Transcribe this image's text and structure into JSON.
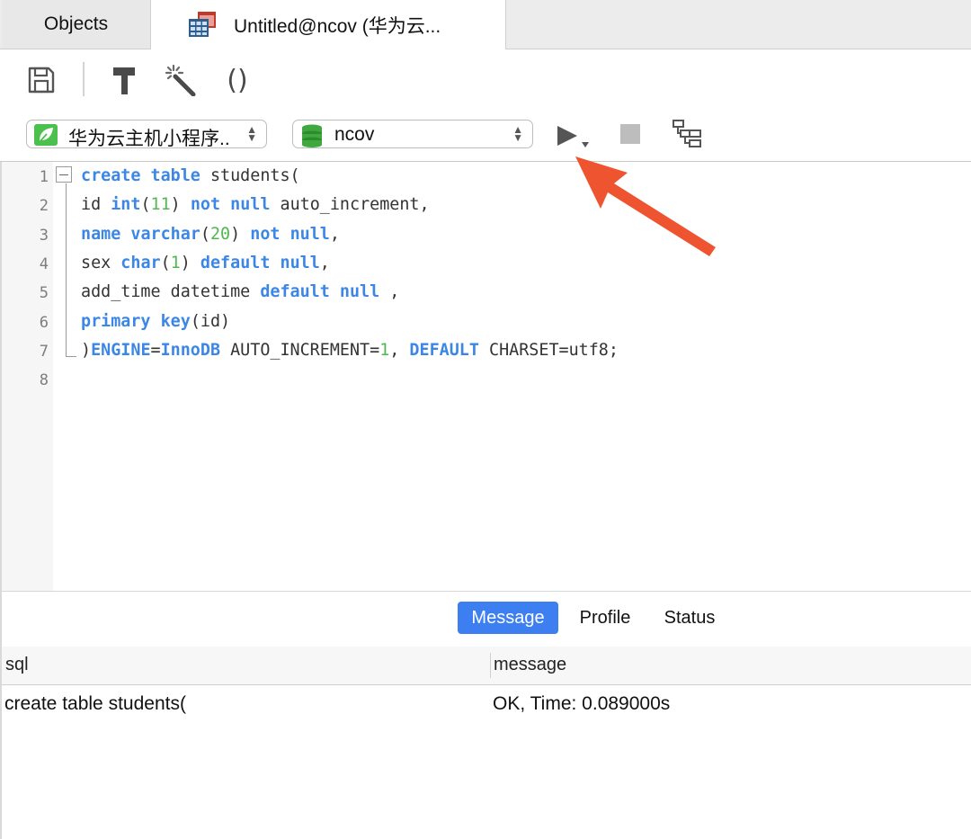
{
  "tabs": {
    "objects": "Objects",
    "query": "Untitled@ncov (华为云..."
  },
  "toolbar": {
    "save_icon": "save-icon",
    "build_icon": "hammer-icon",
    "beautify_icon": "magic-wand-icon",
    "parens_label": "()"
  },
  "connection": {
    "selected": "华为云主机小程序..",
    "icon": "connection-leaf-icon"
  },
  "database": {
    "selected": "ncov",
    "icon": "database-icon"
  },
  "editor": {
    "line_numbers": [
      "1",
      "2",
      "3",
      "4",
      "5",
      "6",
      "7",
      "8"
    ],
    "lines": [
      [
        [
          "kw",
          "create"
        ],
        [
          "t",
          " "
        ],
        [
          "kw",
          "table"
        ],
        [
          "t",
          " students("
        ]
      ],
      [
        [
          "t",
          "id "
        ],
        [
          "kw",
          "int"
        ],
        [
          "t",
          "("
        ],
        [
          "num",
          "11"
        ],
        [
          "t",
          ") "
        ],
        [
          "kw",
          "not"
        ],
        [
          "t",
          " "
        ],
        [
          "kw",
          "null"
        ],
        [
          "t",
          " auto_increment,"
        ]
      ],
      [
        [
          "kw",
          "name"
        ],
        [
          "t",
          " "
        ],
        [
          "kw",
          "varchar"
        ],
        [
          "t",
          "("
        ],
        [
          "num",
          "20"
        ],
        [
          "t",
          ") "
        ],
        [
          "kw",
          "not"
        ],
        [
          "t",
          " "
        ],
        [
          "kw",
          "null"
        ],
        [
          "t",
          ","
        ]
      ],
      [
        [
          "t",
          "sex "
        ],
        [
          "kw",
          "char"
        ],
        [
          "t",
          "("
        ],
        [
          "num",
          "1"
        ],
        [
          "t",
          ") "
        ],
        [
          "kw",
          "default"
        ],
        [
          "t",
          " "
        ],
        [
          "kw",
          "null"
        ],
        [
          "t",
          ","
        ]
      ],
      [
        [
          "t",
          "add_time datetime "
        ],
        [
          "kw",
          "default"
        ],
        [
          "t",
          " "
        ],
        [
          "kw",
          "null"
        ],
        [
          "t",
          " ,"
        ]
      ],
      [
        [
          "kw",
          "primary"
        ],
        [
          "t",
          " "
        ],
        [
          "kw",
          "key"
        ],
        [
          "t",
          "(id)"
        ]
      ],
      [
        [
          "t",
          ")"
        ],
        [
          "kw",
          "ENGINE"
        ],
        [
          "t",
          "="
        ],
        [
          "kw",
          "InnoDB"
        ],
        [
          "t",
          " AUTO_INCREMENT="
        ],
        [
          "num",
          "1"
        ],
        [
          "t",
          ", "
        ],
        [
          "kw",
          "DEFAULT"
        ],
        [
          "t",
          " CHARSET=utf8;"
        ]
      ],
      []
    ]
  },
  "result_tabs": {
    "message": "Message",
    "profile": "Profile",
    "status": "Status"
  },
  "grid": {
    "headers": [
      "sql",
      "message"
    ],
    "rows": [
      [
        "create table students(",
        "OK, Time: 0.089000s"
      ]
    ]
  },
  "colors": {
    "keyword": "#3c87e6",
    "number": "#4fb84f",
    "active_tab": "#3d7ff1",
    "arrow": "#ee5430"
  }
}
